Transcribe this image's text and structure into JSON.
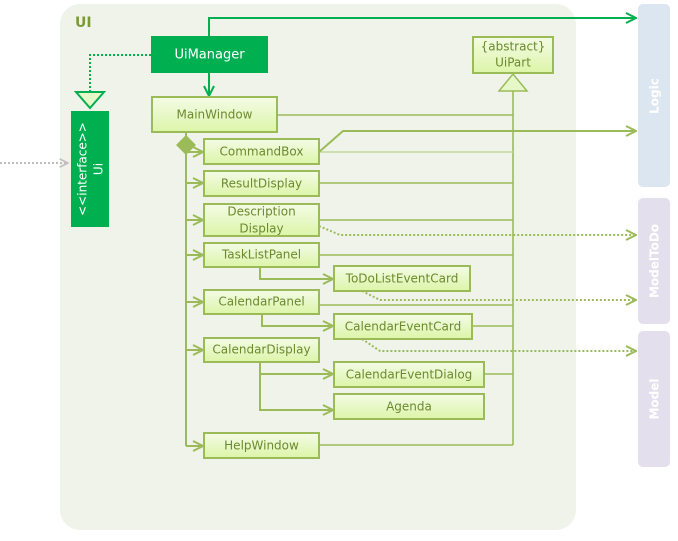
{
  "package": {
    "label": "UI"
  },
  "colors": {
    "accent": "#00b050",
    "class_border": "#9bbb59",
    "package_bg": "#f0f3ea",
    "logic_bg": "#dce6f1",
    "model_bg": "#e4dfec"
  },
  "classes": {
    "ui_manager": "UiManager",
    "ui_interface_stereotype": "<<interface>>",
    "ui_interface": "Ui",
    "ui_part_stereotype": "{abstract}",
    "ui_part": "UiPart",
    "main_window": "MainWindow",
    "command_box": "CommandBox",
    "result_display": "ResultDisplay",
    "description_display_1": "Description",
    "description_display_2": "Display",
    "task_list_panel": "TaskListPanel",
    "todo_list_event_card": "ToDoListEventCard",
    "calendar_panel": "CalendarPanel",
    "calendar_event_card": "CalendarEventCard",
    "calendar_display": "CalendarDisplay",
    "calendar_event_dialog": "CalendarEventDialog",
    "agenda": "Agenda",
    "help_window": "HelpWindow"
  },
  "external": {
    "logic": "Logic",
    "model_todo": "ModelToDo",
    "model": "Model"
  }
}
